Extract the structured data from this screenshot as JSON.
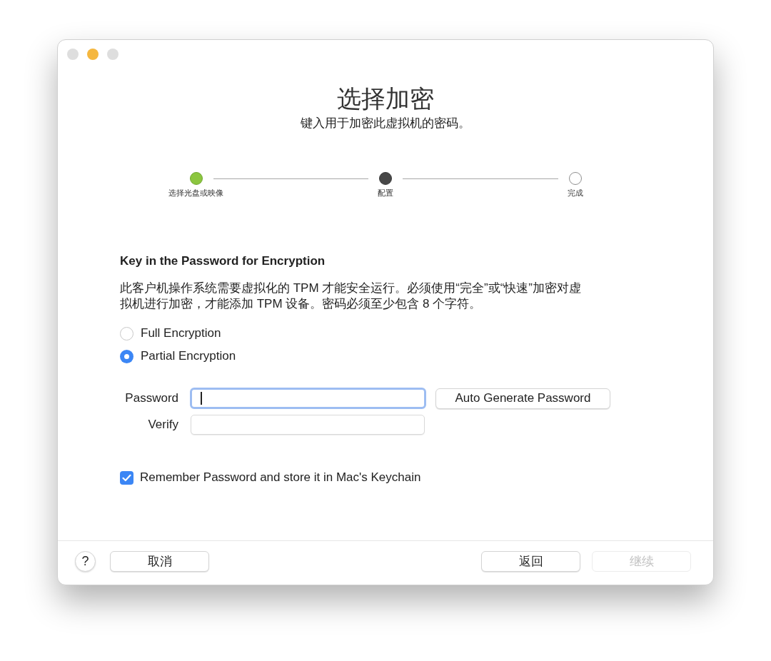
{
  "window": {
    "traffic_lights": [
      {
        "color": "#dedede"
      },
      {
        "color": "#f5b73f"
      },
      {
        "color": "#dedede"
      }
    ]
  },
  "header": {
    "title": "选择加密",
    "subtitle": "键入用于加密此虚拟机的密码。"
  },
  "steps": [
    {
      "label": "选择光盘或映像",
      "kind": "done"
    },
    {
      "label": "配置",
      "kind": "current"
    },
    {
      "label": "完成",
      "kind": "pending"
    }
  ],
  "section": {
    "heading": "Key in the Password for Encryption",
    "description": "此客户机操作系统需要虚拟化的 TPM 才能安全运行。必须使用“完全”或“快速”加密对虚拟机进行加密，才能添加 TPM 设备。密码必须至少包含 8 个字符。"
  },
  "encryption_options": [
    {
      "label": "Full Encryption",
      "selected": false
    },
    {
      "label": "Partial Encryption",
      "selected": true
    }
  ],
  "password_fields": [
    {
      "label": "Password",
      "focused": true
    },
    {
      "label": "Verify",
      "focused": false
    }
  ],
  "auto_generate_button": {
    "label": "Auto Generate Password"
  },
  "remember_checkbox": {
    "label": "Remember Password and store it in Mac's Keychain",
    "checked": true
  },
  "footer": {
    "help": "?",
    "cancel": {
      "label": "取消",
      "disabled": false
    },
    "navigation": [
      {
        "label": "返回",
        "disabled": false
      },
      {
        "label": "继续",
        "disabled": true
      }
    ]
  }
}
